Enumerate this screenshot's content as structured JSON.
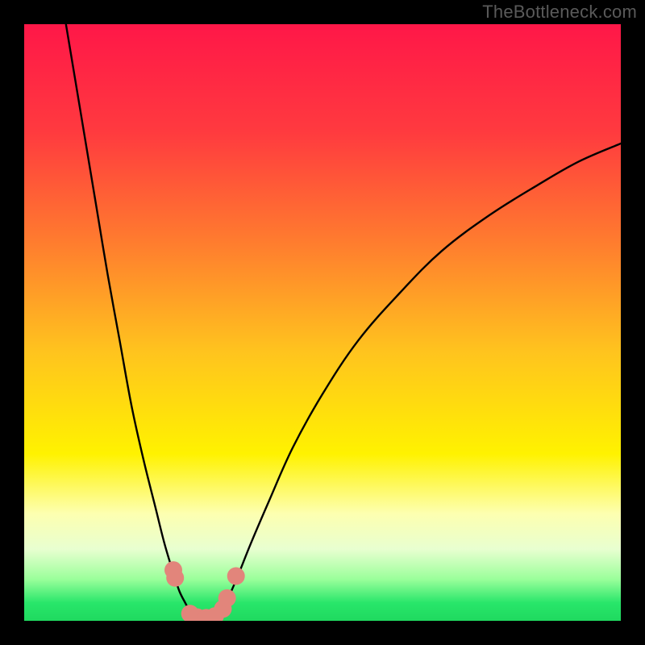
{
  "watermark": "TheBottleneck.com",
  "chart_data": {
    "type": "line",
    "title": "",
    "xlabel": "",
    "ylabel": "",
    "xlim": [
      0,
      100
    ],
    "ylim": [
      0,
      100
    ],
    "grid": false,
    "legend": false,
    "gradient_stops": [
      {
        "offset": 0.0,
        "color": "#ff1748"
      },
      {
        "offset": 0.18,
        "color": "#ff3a3f"
      },
      {
        "offset": 0.36,
        "color": "#ff7a2f"
      },
      {
        "offset": 0.55,
        "color": "#ffc41e"
      },
      {
        "offset": 0.72,
        "color": "#fff200"
      },
      {
        "offset": 0.82,
        "color": "#fdffb0"
      },
      {
        "offset": 0.88,
        "color": "#e8ffd0"
      },
      {
        "offset": 0.93,
        "color": "#9bff9b"
      },
      {
        "offset": 0.97,
        "color": "#28e66a"
      },
      {
        "offset": 1.0,
        "color": "#1fd95f"
      }
    ],
    "series": [
      {
        "name": "curve-left",
        "color": "#000000",
        "x": [
          7.0,
          8.5,
          10.0,
          12.0,
          14.0,
          16.0,
          18.0,
          20.0,
          22.0,
          23.5,
          25.0,
          26.0,
          27.0,
          27.8
        ],
        "y": [
          100.0,
          91.0,
          82.0,
          70.0,
          58.0,
          47.0,
          36.0,
          27.0,
          19.0,
          13.0,
          8.0,
          5.0,
          3.0,
          1.5
        ]
      },
      {
        "name": "curve-right",
        "color": "#000000",
        "x": [
          33.0,
          34.5,
          36.0,
          38.0,
          41.0,
          45.0,
          50.0,
          56.0,
          63.0,
          70.0,
          78.0,
          86.0,
          93.0,
          100.0
        ],
        "y": [
          1.5,
          4.5,
          8.0,
          13.0,
          20.0,
          29.0,
          38.0,
          47.0,
          55.0,
          62.0,
          68.0,
          73.0,
          77.0,
          80.0
        ]
      },
      {
        "name": "curve-bottom",
        "color": "#000000",
        "x": [
          27.8,
          28.5,
          29.5,
          30.5,
          31.5,
          32.3,
          33.0
        ],
        "y": [
          1.5,
          0.8,
          0.4,
          0.4,
          0.5,
          0.9,
          1.5
        ]
      }
    ],
    "markers": {
      "name": "dots-series",
      "color": "#e2857b",
      "radius_px": 11,
      "points": [
        {
          "x": 25.0,
          "y": 8.5
        },
        {
          "x": 25.3,
          "y": 7.2
        },
        {
          "x": 27.8,
          "y": 1.2
        },
        {
          "x": 29.0,
          "y": 0.6
        },
        {
          "x": 30.5,
          "y": 0.5
        },
        {
          "x": 32.0,
          "y": 0.8
        },
        {
          "x": 33.3,
          "y": 2.0
        },
        {
          "x": 34.0,
          "y": 3.8
        },
        {
          "x": 35.5,
          "y": 7.5
        }
      ]
    }
  }
}
